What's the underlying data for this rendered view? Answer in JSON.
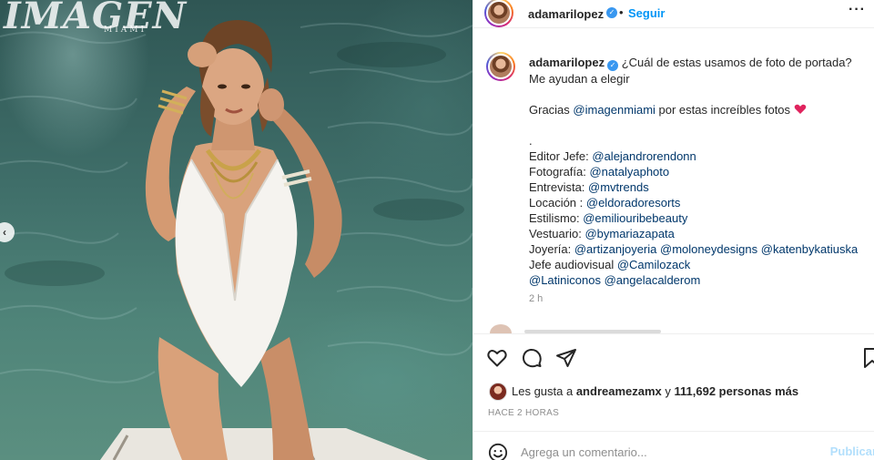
{
  "post": {
    "watermark": {
      "brand": "IMAGEN",
      "city": "MIAMI"
    },
    "header": {
      "username": "adamarilopez",
      "separator": "•",
      "follow_label": "Seguir",
      "more_icon": "more-horizontal-icon"
    },
    "caption": {
      "username": "adamarilopez",
      "line1": "¿Cuál de estas usamos de foto de portada? Me ayudan a elegir",
      "thanks_prefix": "Gracias ",
      "thanks_mention": "@imagenmiami",
      "thanks_suffix": " por estas increíbles fotos",
      "dot": ".",
      "credits": [
        {
          "label": "Editor Jefe: ",
          "mentions": [
            "@alejandrorendonn"
          ]
        },
        {
          "label": "Fotografía: ",
          "mentions": [
            "@natalyaphoto"
          ]
        },
        {
          "label": "Entrevista: ",
          "mentions": [
            "@mvtrends"
          ]
        },
        {
          "label": "Locación : ",
          "mentions": [
            "@eldoradoresorts"
          ]
        },
        {
          "label": "Estilismo: ",
          "mentions": [
            "@emiliouribebeauty"
          ]
        },
        {
          "label": "Vestuario: ",
          "mentions": [
            "@bymariazapata"
          ]
        },
        {
          "label": "Joyería: ",
          "mentions": [
            "@artizanjoyeria",
            "@moloneydesigns",
            "@katenbykatiuska"
          ]
        },
        {
          "label": "Jefe audiovisual ",
          "mentions": [
            "@Camilozack"
          ]
        },
        {
          "label": "",
          "mentions": [
            "@Latiniconos",
            "@angelacalderom"
          ]
        }
      ],
      "time": "2 h"
    },
    "actions": {
      "like_icon": "heart-icon",
      "comment_icon": "comment-icon",
      "share_icon": "share-icon",
      "save_icon": "bookmark-icon"
    },
    "likes": {
      "prefix": "Les gusta a ",
      "user": "andreamezamx",
      "middle": " y ",
      "count": "111,692 personas más"
    },
    "time_ago": "HACE 2 HORAS",
    "comment": {
      "placeholder": "Agrega un comentario...",
      "publish_label": "Publicar",
      "emoji_icon": "smiley-icon"
    },
    "colors": {
      "accent": "#0095f6",
      "mention": "#00376b",
      "verified": "#3897f0",
      "publish_disabled": "#b2dffc",
      "heart_emoji": "#e0245e"
    }
  }
}
